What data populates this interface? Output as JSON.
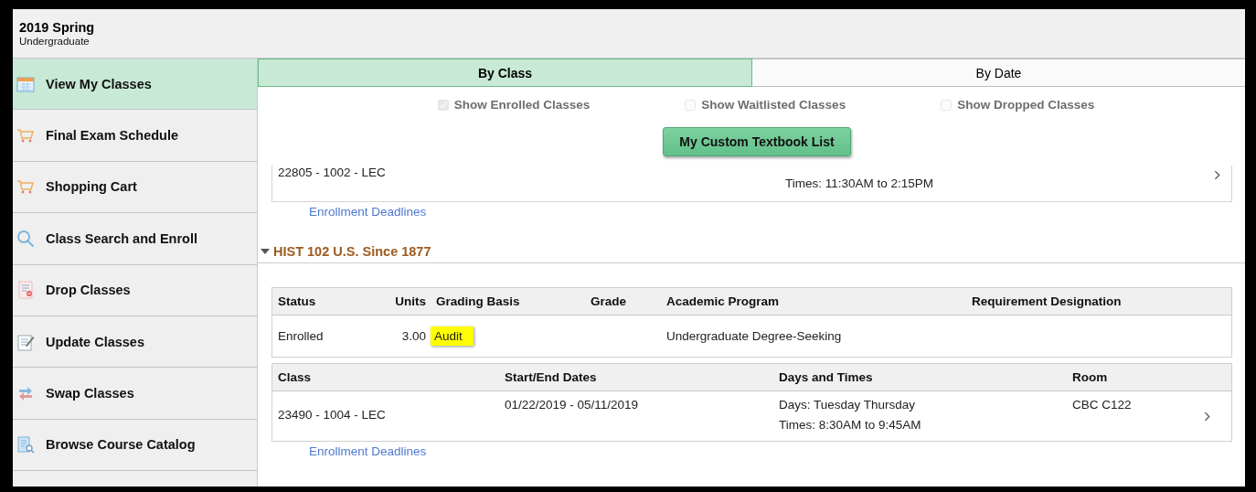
{
  "header": {
    "term": "2019 Spring",
    "career": "Undergraduate"
  },
  "sidebar": {
    "items": [
      {
        "label": "View My Classes",
        "kind": "calendar",
        "selected": true
      },
      {
        "label": "Final Exam Schedule",
        "kind": "cart",
        "selected": false
      },
      {
        "label": "Shopping Cart",
        "kind": "cart",
        "selected": false
      },
      {
        "label": "Class Search and Enroll",
        "kind": "search",
        "selected": false
      },
      {
        "label": "Drop Classes",
        "kind": "drop",
        "selected": false
      },
      {
        "label": "Update Classes",
        "kind": "edit",
        "selected": false
      },
      {
        "label": "Swap Classes",
        "kind": "swap",
        "selected": false
      },
      {
        "label": "Browse Course Catalog",
        "kind": "catalog",
        "selected": false
      }
    ]
  },
  "tabs": [
    {
      "label": "By Class",
      "selected": true
    },
    {
      "label": "By Date",
      "selected": false
    }
  ],
  "filters": [
    {
      "label": "Show Enrolled Classes",
      "checked": true
    },
    {
      "label": "Show Waitlisted Classes",
      "checked": false
    },
    {
      "label": "Show Dropped Classes",
      "checked": false
    }
  ],
  "textbook_button": "My Custom Textbook List",
  "previous_class": {
    "class": "22805 - 1002 - LEC",
    "times": "Times: 11:30AM to 2:15PM",
    "link": "Enrollment Deadlines"
  },
  "course": {
    "title": "HIST 102 U.S. Since 1877",
    "expanded": true,
    "enrollment_table": {
      "columns": [
        "Status",
        "Units",
        "Grading Basis",
        "Grade",
        "Academic Program",
        "Requirement Designation"
      ],
      "row": {
        "status": "Enrolled",
        "units": "3.00",
        "grading_basis": "Audit",
        "grading_basis_highlighted": true,
        "academic_program": "Undergraduate Degree-Seeking"
      }
    },
    "class_table": {
      "columns": [
        "Class",
        "Start/End Dates",
        "Days and Times",
        "Room"
      ],
      "row": {
        "class": "23490 - 1004 - LEC",
        "dates": "01/22/2019 - 05/11/2019",
        "days": "Days: Tuesday Thursday",
        "times": "Times: 8:30AM to 9:45AM",
        "room": "CBC C122"
      }
    },
    "link": "Enrollment Deadlines"
  }
}
